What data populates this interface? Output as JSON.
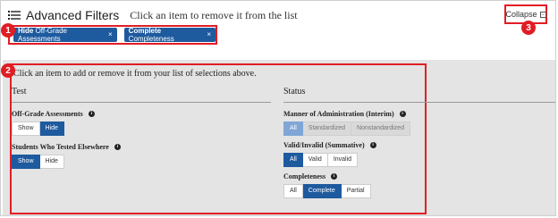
{
  "header": {
    "title": "Advanced Filters",
    "subtitle": "Click an item to remove it from the list",
    "collapse_label": "Collapse"
  },
  "selected_chips": [
    {
      "bold": "Hide",
      "rest": "Off-Grade Assessments"
    },
    {
      "bold": "Complete",
      "rest": "Completeness"
    }
  ],
  "panel": {
    "instruction": "Click an item to add or remove it from your list of selections above.",
    "test": {
      "heading": "Test",
      "groups": [
        {
          "label": "Off-Grade Assessments",
          "options": [
            "Show",
            "Hide"
          ]
        },
        {
          "label": "Students Who Tested Elsewhere",
          "options": [
            "Show",
            "Hide"
          ]
        }
      ]
    },
    "status": {
      "heading": "Status",
      "groups": [
        {
          "label": "Manner of Administration (Interim)",
          "options": [
            "All",
            "Standardized",
            "Nonstandardized"
          ]
        },
        {
          "label": "Valid/Invalid (Summative)",
          "options": [
            "All",
            "Valid",
            "Invalid"
          ]
        },
        {
          "label": "Completeness",
          "options": [
            "All",
            "Complete",
            "Partial"
          ]
        }
      ]
    }
  },
  "callouts": [
    "1",
    "2",
    "3"
  ],
  "info_glyph": "i",
  "close_glyph": "×",
  "colors": {
    "accent": "#1e5a9e",
    "callout": "#e11d24",
    "panel_bg": "#e4e4e4"
  }
}
